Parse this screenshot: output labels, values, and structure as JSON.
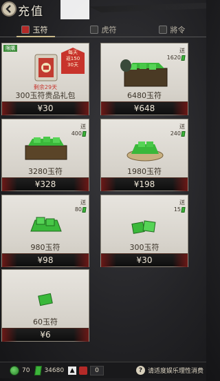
{
  "header": {
    "title": "充值"
  },
  "tabs": [
    {
      "label": "玉符",
      "active": true
    },
    {
      "label": "虎符",
      "active": false
    },
    {
      "label": "將令",
      "active": false
    }
  ],
  "cards": [
    {
      "tag": "限購",
      "badge_line1": "每天",
      "badge_line2": "返150",
      "badge_line3": "30天",
      "timer": "剩余29天",
      "bonus_label": "",
      "bonus_amount": "",
      "name": "300玉符贵品礼包",
      "price": "¥30"
    },
    {
      "tag": "",
      "bonus_label": "送",
      "bonus_amount": "1620",
      "name": "6480玉符",
      "price": "¥648"
    },
    {
      "tag": "",
      "bonus_label": "送",
      "bonus_amount": "400",
      "name": "3280玉符",
      "price": "¥328"
    },
    {
      "tag": "",
      "bonus_label": "送",
      "bonus_amount": "240",
      "name": "1980玉符",
      "price": "¥198"
    },
    {
      "tag": "",
      "bonus_label": "送",
      "bonus_amount": "80",
      "name": "980玉符",
      "price": "¥98"
    },
    {
      "tag": "",
      "bonus_label": "送",
      "bonus_amount": "15",
      "name": "300玉符",
      "price": "¥30"
    },
    {
      "tag": "",
      "bonus_label": "",
      "bonus_amount": "",
      "name": "60玉符",
      "price": "¥6"
    }
  ],
  "bottom": {
    "coin_value": "70",
    "jade_value": "34680",
    "up_symbol": "▲",
    "ticket_value": "0",
    "notice": "请适度娱乐理性消费"
  },
  "colors": {
    "accent_red": "#b42a28",
    "jade_green": "#3cb43a",
    "card_bg": "#e7e4de"
  }
}
